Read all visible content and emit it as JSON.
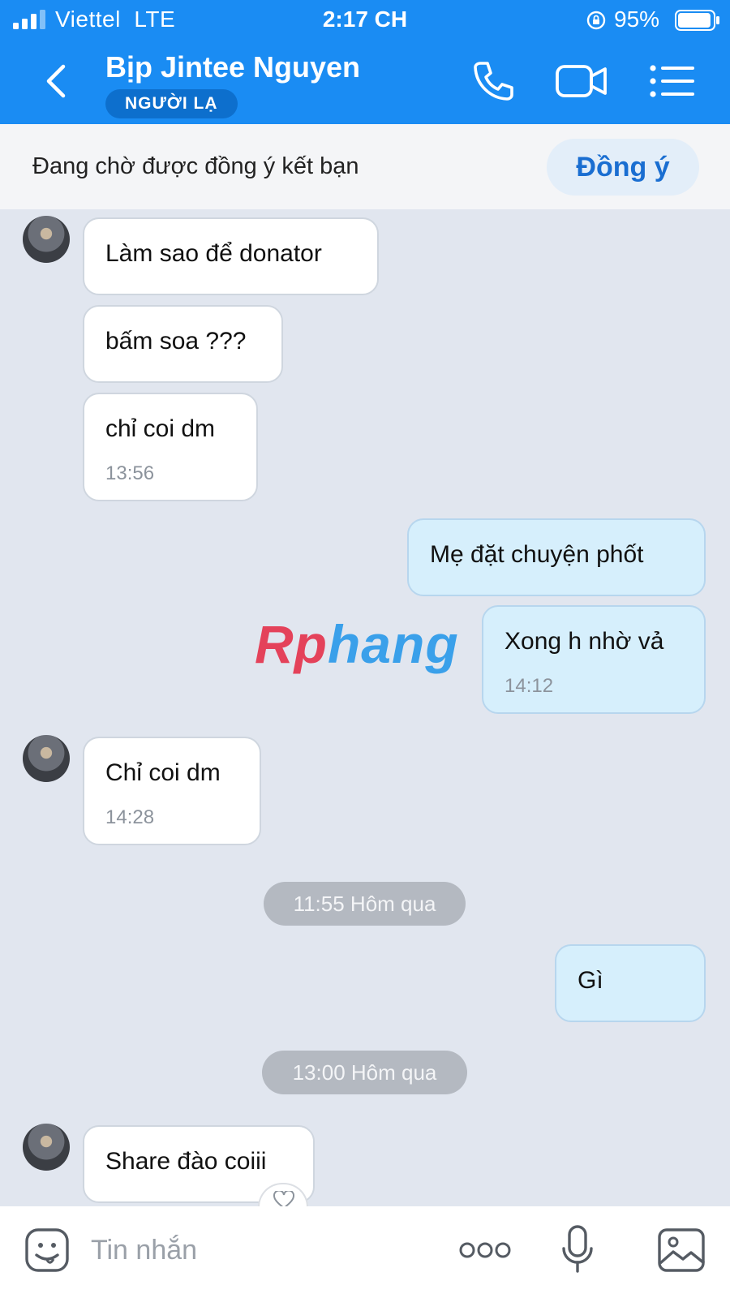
{
  "status_bar": {
    "carrier": "Viettel",
    "network": "LTE",
    "time": "2:17 CH",
    "battery": "95%",
    "battery_level": 0.95
  },
  "header": {
    "contact_name": "Bịp Jintee Nguyen",
    "badge": "NGƯỜI LẠ",
    "icons": [
      "back-icon",
      "phone-icon",
      "video-camera-icon",
      "menu-list-icon"
    ],
    "color": "#1a8cf3"
  },
  "friend_request": {
    "text": "Đang chờ được đồng ý kết bạn",
    "accept_label": "Đồng ý"
  },
  "messages": [
    {
      "sender": "contact",
      "text": "Làm sao để donator"
    },
    {
      "sender": "contact",
      "text": "bấm soa ???"
    },
    {
      "sender": "contact",
      "text": "chỉ coi dm",
      "time": "13:56"
    },
    {
      "sender": "me",
      "text": "Mẹ đặt chuyện phốt"
    },
    {
      "sender": "me",
      "text": "Xong h nhờ vả",
      "time": "14:12"
    },
    {
      "sender": "contact",
      "text": "Chỉ coi dm",
      "time": "14:28"
    },
    {
      "separator": "11:55 Hôm qua"
    },
    {
      "sender": "me",
      "text": "Gì"
    },
    {
      "separator": "13:00 Hôm qua"
    },
    {
      "sender": "contact",
      "text": "Share đào coiii"
    }
  ],
  "watermark": {
    "part1": "Rp",
    "part2": "hang"
  },
  "input_bar": {
    "placeholder": "Tin nhắn",
    "icons": [
      "emoji-icon",
      "more-icon",
      "microphone-icon",
      "gallery-icon"
    ]
  },
  "colors": {
    "accent": "#1a8cf3",
    "my_bubble": "#d6effc",
    "chat_background": "#e1e6ef"
  }
}
